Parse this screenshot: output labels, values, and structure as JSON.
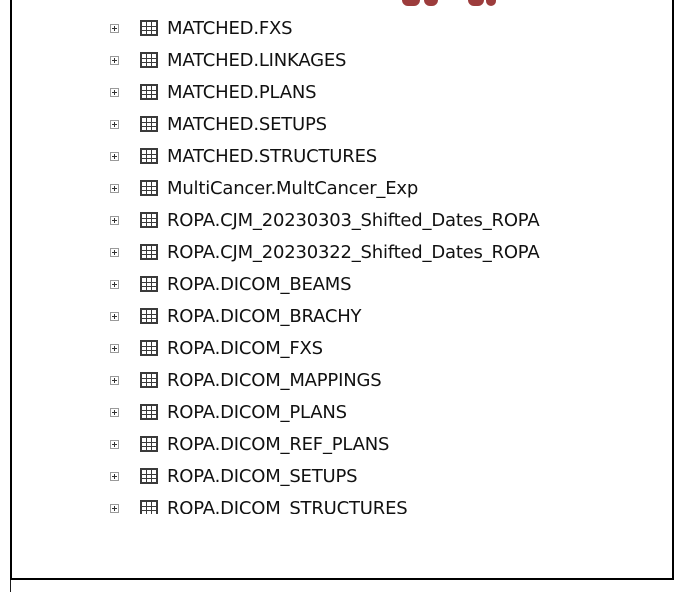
{
  "tree": {
    "items": [
      {
        "label": "MATCHED.FXS",
        "icon": "table-icon",
        "expander": "plus"
      },
      {
        "label": "MATCHED.LINKAGES",
        "icon": "table-icon",
        "expander": "plus"
      },
      {
        "label": "MATCHED.PLANS",
        "icon": "table-icon",
        "expander": "plus"
      },
      {
        "label": "MATCHED.SETUPS",
        "icon": "table-icon",
        "expander": "plus"
      },
      {
        "label": "MATCHED.STRUCTURES",
        "icon": "table-icon",
        "expander": "plus"
      },
      {
        "label": "MultiCancer.MultCancer_Exp",
        "icon": "table-icon",
        "expander": "plus"
      },
      {
        "label": "ROPA.CJM_20230303_Shifted_Dates_ROPA",
        "icon": "table-icon",
        "expander": "plus"
      },
      {
        "label": "ROPA.CJM_20230322_Shifted_Dates_ROPA",
        "icon": "table-icon",
        "expander": "plus"
      },
      {
        "label": "ROPA.DICOM_BEAMS",
        "icon": "table-icon",
        "expander": "plus"
      },
      {
        "label": "ROPA.DICOM_BRACHY",
        "icon": "table-icon",
        "expander": "plus"
      },
      {
        "label": "ROPA.DICOM_FXS",
        "icon": "table-icon",
        "expander": "plus"
      },
      {
        "label": "ROPA.DICOM_MAPPINGS",
        "icon": "table-icon",
        "expander": "plus"
      },
      {
        "label": "ROPA.DICOM_PLANS",
        "icon": "table-icon",
        "expander": "plus"
      },
      {
        "label": "ROPA.DICOM_REF_PLANS",
        "icon": "table-icon",
        "expander": "plus"
      },
      {
        "label": "ROPA.DICOM_SETUPS",
        "icon": "table-icon",
        "expander": "plus"
      },
      {
        "label": "ROPA.DICOM_STRUCTURES",
        "icon": "table-icon",
        "expander": "plus",
        "partially_visible": true
      }
    ]
  },
  "colors": {
    "text": "#111111",
    "frame": "#000000",
    "icon": "#3a3a3a",
    "decoration_red": "#8b1a1a"
  }
}
